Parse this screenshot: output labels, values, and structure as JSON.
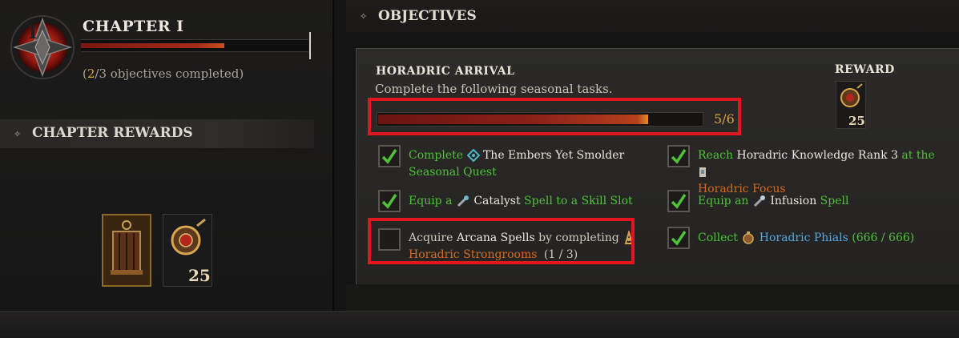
{
  "chapter": {
    "title": "CHAPTER I",
    "numeral": "I",
    "completed": "2",
    "completed_rest": "/3 objectives completed)",
    "completed_open": "(",
    "progress_fraction": 0.63
  },
  "chapter_rewards": {
    "title": "CHAPTER REWARDS",
    "items": [
      {
        "name": "cage-trophy",
        "count": ""
      },
      {
        "name": "horadric-sigil",
        "count": "25"
      }
    ]
  },
  "objectives": {
    "title": "OBJECTIVES",
    "quest": {
      "title": "HORADRIC ARRIVAL",
      "description": "Complete the following seasonal tasks.",
      "progress_text": "5/6",
      "progress_fraction": 0.8333,
      "reward_label": "REWARD",
      "reward_count": "25"
    },
    "tasks": [
      {
        "checked": true,
        "parts": [
          "Complete",
          "The Embers Yet Smolder",
          "Seasonal Quest"
        ]
      },
      {
        "checked": true,
        "parts": [
          "Reach",
          "Horadric Knowledge Rank 3",
          "at the",
          "Horadric Focus"
        ]
      },
      {
        "checked": true,
        "parts": [
          "Equip a",
          "Catalyst",
          "Spell to a Skill Slot"
        ]
      },
      {
        "checked": true,
        "parts": [
          "Equip an",
          "Infusion",
          "Spell"
        ]
      },
      {
        "checked": false,
        "parts": [
          "Acquire",
          "Arcana Spells",
          "by completing",
          "Horadric Strongrooms",
          "(1 / 3)"
        ]
      },
      {
        "checked": true,
        "parts": [
          "Collect",
          "Horadric Phials",
          "(666 / 666)"
        ]
      }
    ]
  },
  "colors": {
    "accent_green": "#4fc23a",
    "accent_orange": "#d46b23",
    "accent_blue": "#56a6e0",
    "highlight_red": "#e0171f"
  }
}
